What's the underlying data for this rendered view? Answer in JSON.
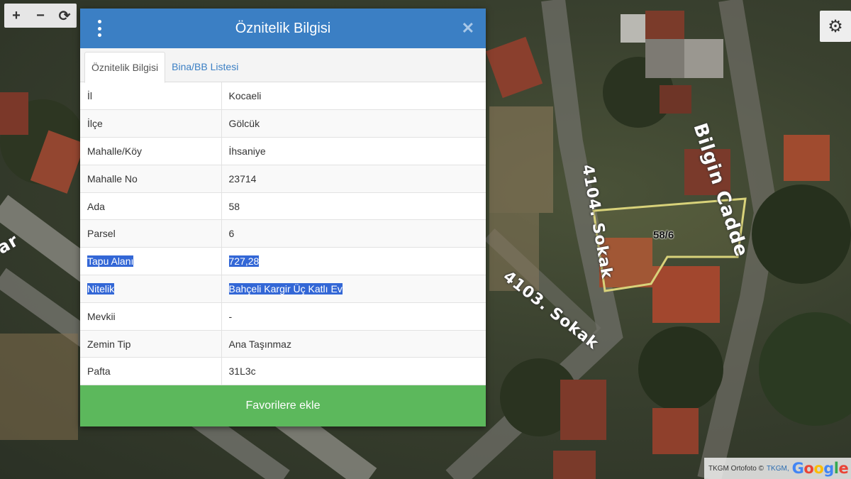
{
  "map": {
    "labels": {
      "bilgin": "Bilgin Cadde",
      "s4104": "4104. Sokak",
      "s4103": "4103. Sokak",
      "partial": "ar"
    },
    "parcel_label": "58/6",
    "parcel_outline_color": "#d8d27a"
  },
  "controls": {
    "zoom_in": "+",
    "zoom_out": "−",
    "refresh": "⟳",
    "settings": "⚙"
  },
  "attribution": {
    "prefix": "TKGM Ortofoto ©",
    "link": "TKGM,",
    "google": "Google"
  },
  "dialog": {
    "title": "Öznitelik Bilgisi",
    "close": "✕",
    "tabs": [
      {
        "label": "Öznitelik Bilgisi"
      },
      {
        "label": "Bina/BB Listesi"
      }
    ],
    "rows": [
      {
        "key": "İl",
        "value": "Kocaeli"
      },
      {
        "key": "İlçe",
        "value": "Gölcük"
      },
      {
        "key": "Mahalle/Köy",
        "value": "İhsaniye"
      },
      {
        "key": "Mahalle No",
        "value": "23714"
      },
      {
        "key": "Ada",
        "value": "58"
      },
      {
        "key": "Parsel",
        "value": "6"
      },
      {
        "key": "Tapu Alanı",
        "value": "727,28"
      },
      {
        "key": "Nitelik",
        "value": "Bahçeli Kargir Üç Katlı Ev"
      },
      {
        "key": "Mevkii",
        "value": "-"
      },
      {
        "key": "Zemin Tip",
        "value": "Ana Taşınmaz"
      },
      {
        "key": "Pafta",
        "value": "31L3c"
      }
    ],
    "favorite_button": "Favorilere ekle"
  },
  "colors": {
    "header": "#3b7fc4",
    "favorite": "#5cb85c",
    "selection": "#3367d6"
  }
}
